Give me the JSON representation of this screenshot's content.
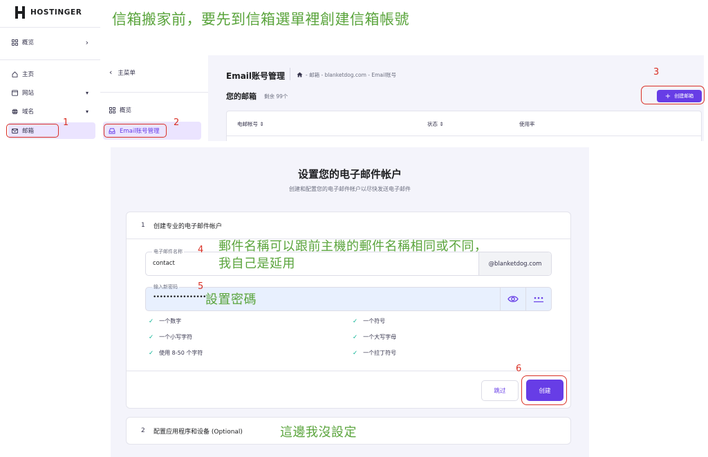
{
  "heading_annotation": "信箱搬家前，要先到信箱選單裡創建信箱帳號",
  "brand": {
    "name": "HOSTINGER"
  },
  "sidebar": {
    "items": [
      {
        "label": "概览",
        "icon": "grid-icon",
        "caret": "›"
      },
      {
        "label": "主页",
        "icon": "home-icon"
      },
      {
        "label": "网站",
        "icon": "browser-icon",
        "caret": "▾"
      },
      {
        "label": "域名",
        "icon": "globe-icon",
        "caret": "▾"
      },
      {
        "label": "邮箱",
        "icon": "mail-icon"
      }
    ]
  },
  "submenu": {
    "back_label": "主菜单",
    "back_icon": "‹",
    "items": [
      {
        "label": "概览",
        "icon": "grid-icon"
      },
      {
        "label": "Email账号管理",
        "icon": "inbox-icon"
      }
    ]
  },
  "email_panel": {
    "title": "Email账号管理",
    "breadcrumb": {
      "home_icon": "home-icon",
      "trail": "- 邮箱 - blanketdog.com - Email账号"
    },
    "mailbox_title": "您的邮箱",
    "mailbox_remaining": "剩余 99个",
    "create_button": "创建邮箱",
    "create_button_icon": "+",
    "columns": [
      {
        "label": "电邮帐号 ⇕"
      },
      {
        "label": "状态 ⇕"
      },
      {
        "label": "使用率"
      }
    ]
  },
  "setup": {
    "title": "设置您的电子邮件帐户",
    "subtitle": "创建和配置您的电子邮件帐户以尽快发送电子邮件",
    "step1": {
      "number": "1",
      "label": "创建专业的电子邮件帐户",
      "name_field": {
        "label": "电子邮件名称",
        "value": "contact",
        "domain": "@blanketdog.com"
      },
      "password_field": {
        "label": "输入新密码",
        "value": "••••••••••••••••",
        "eye_icon": "eye-icon",
        "generate_icon": "dots-icon"
      },
      "requirements": [
        "一个数字",
        "一个符号",
        "一个小写字符",
        "一个大写字母",
        "使用 8-50 个字符",
        "一个拉丁符号"
      ],
      "skip_button": "跳过",
      "create_button": "创建"
    },
    "step2": {
      "number": "2",
      "label": "配置应用程序和设备 (Optional)"
    }
  },
  "annotations": {
    "numbers": [
      "1",
      "2",
      "3",
      "4",
      "5",
      "6"
    ],
    "name_note_line1": "郵件名稱可以跟前主機的郵件名稱相同或不同，",
    "name_note_line2": "我自己是延用",
    "password_note": "設置密碼",
    "step2_note": "這邊我沒設定"
  },
  "colors": {
    "accent": "#673de6",
    "annotation_red": "#d93025",
    "annotation_green": "#5aa43c",
    "check_green": "#00b090"
  }
}
